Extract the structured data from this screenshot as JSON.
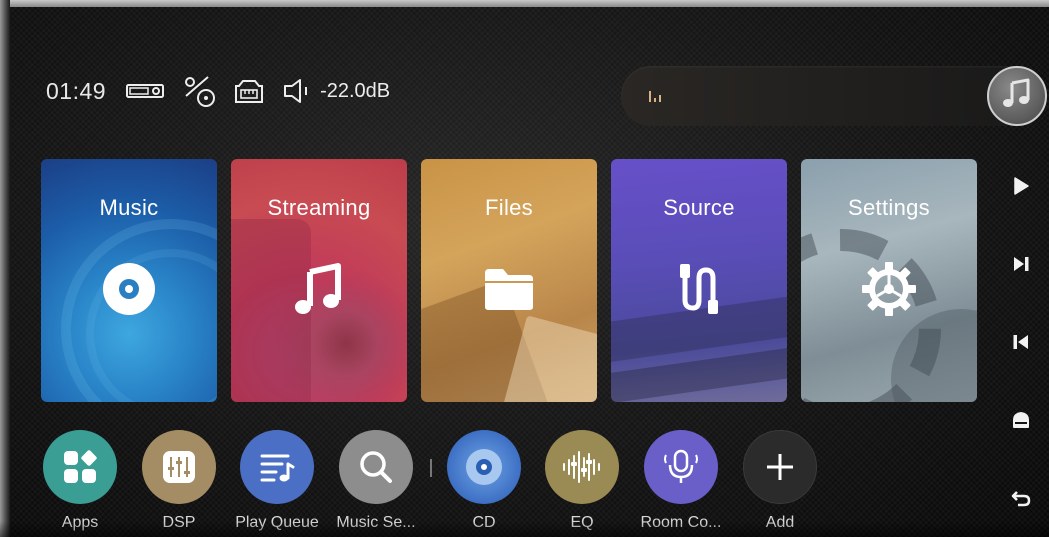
{
  "status": {
    "time": "01:49",
    "volume": "-22.0dB",
    "icons": [
      "projector-icon",
      "percent-disc-icon",
      "ethernet-icon",
      "speaker-icon"
    ]
  },
  "now_playing": {
    "icon": "music-note-icon",
    "bars_icon": "audio-level-icon"
  },
  "tiles": [
    {
      "label": "Music",
      "icon": "disc-icon",
      "color": "#2a86c9"
    },
    {
      "label": "Streaming",
      "icon": "music-note-icon",
      "color": "#c13a5a"
    },
    {
      "label": "Files",
      "icon": "folder-icon",
      "color": "#c99345"
    },
    {
      "label": "Source",
      "icon": "cable-icon",
      "color": "#5a4db8"
    },
    {
      "label": "Settings",
      "icon": "gear-icon",
      "color": "#8aa0ad"
    }
  ],
  "transport": [
    "play-icon",
    "next-icon",
    "previous-icon",
    "home-icon",
    "back-icon"
  ],
  "dock": [
    {
      "label": "Apps",
      "icon": "apps-icon",
      "color": "#3a9e94"
    },
    {
      "label": "DSP",
      "icon": "dsp-sliders-icon",
      "color": "#a48d64"
    },
    {
      "label": "Play Queue",
      "icon": "queue-icon",
      "color": "#4a6fc4"
    },
    {
      "label": "Music Se...",
      "icon": "search-icon",
      "color": "#8d8d8d"
    },
    {
      "label": "CD",
      "icon": "cd-icon",
      "color": "#3d6fc4"
    },
    {
      "label": "EQ",
      "icon": "eq-icon",
      "color": "#9a8a54"
    },
    {
      "label": "Room Co...",
      "icon": "microphone-icon",
      "color": "#6a5fc8"
    },
    {
      "label": "Add",
      "icon": "plus-icon",
      "color": "#2b2b2b"
    }
  ]
}
